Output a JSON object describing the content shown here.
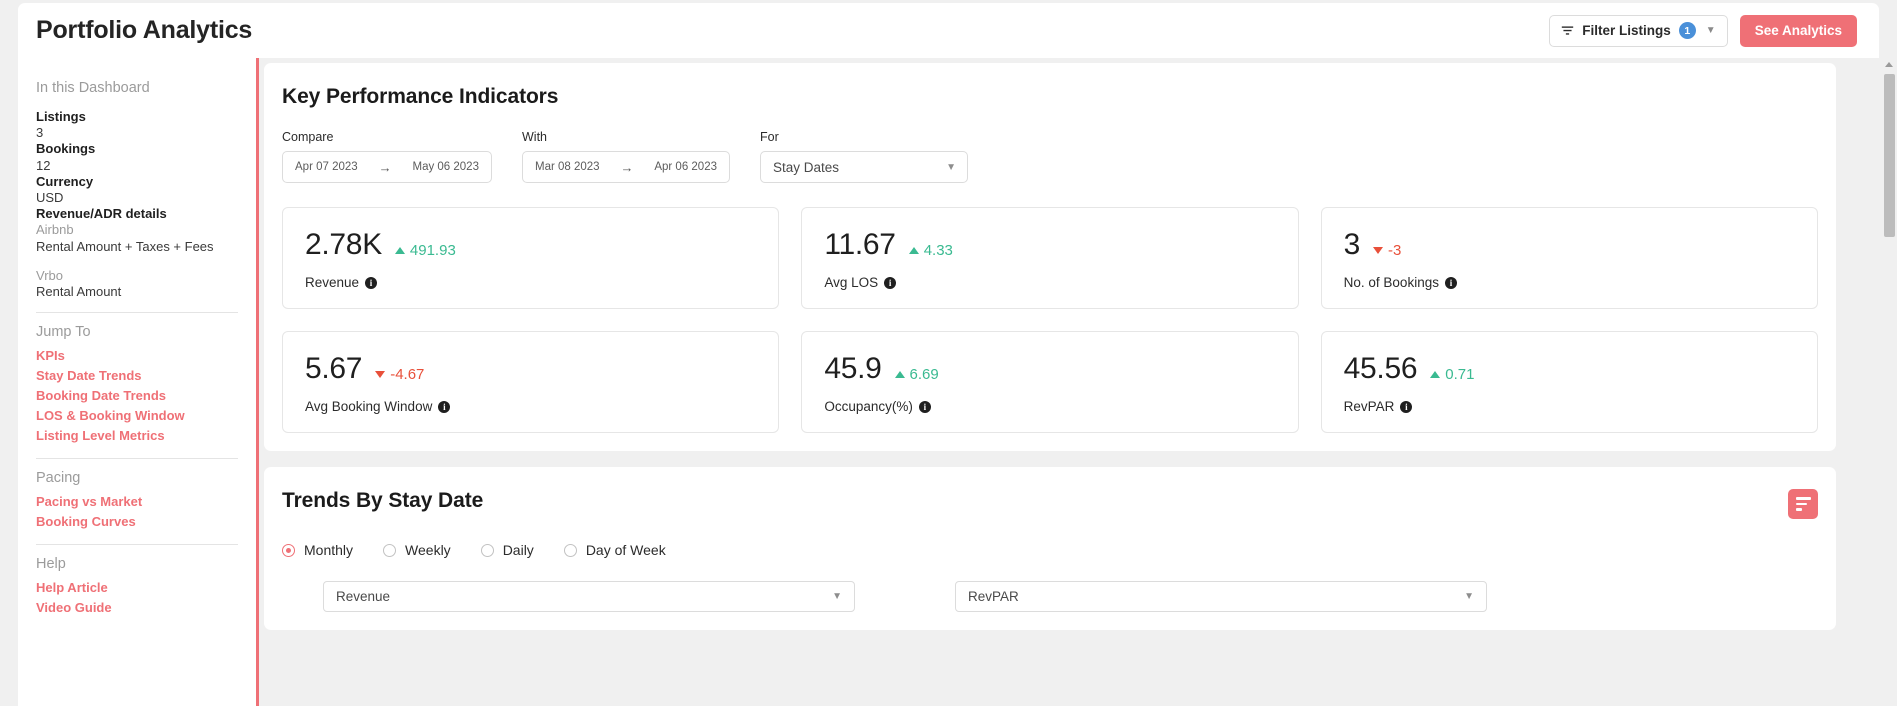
{
  "header": {
    "title": "Portfolio Analytics",
    "filter_button": {
      "label": "Filter Listings",
      "count": "1",
      "icon": "filter-icon"
    },
    "primary_button": {
      "label": "See Analytics"
    }
  },
  "sidebar": {
    "group_title": "In this Dashboard",
    "stats": [
      {
        "key": "Listings",
        "value": "3"
      },
      {
        "key": "Bookings",
        "value": "12"
      },
      {
        "key": "Currency",
        "value": "USD"
      }
    ],
    "revenue_details_title": "Revenue/ADR details",
    "channels": [
      {
        "name": "Airbnb",
        "formula": "Rental Amount + Taxes + Fees"
      },
      {
        "name": "Vrbo",
        "formula": "Rental Amount"
      }
    ],
    "jump_to": {
      "title": "Jump To",
      "links": [
        "KPIs",
        "Stay Date Trends",
        "Booking Date Trends",
        "LOS & Booking Window",
        "Listing Level Metrics"
      ]
    },
    "pacing": {
      "title": "Pacing",
      "links": [
        "Pacing vs Market",
        "Booking Curves"
      ]
    },
    "help": {
      "title": "Help",
      "links": [
        "Help Article",
        "Video Guide"
      ]
    }
  },
  "kpi_section": {
    "title": "Key Performance Indicators",
    "filters": {
      "compare": {
        "label": "Compare",
        "start": "Apr 07 2023",
        "end": "May 06 2023",
        "arrow": "→"
      },
      "with": {
        "label": "With",
        "start": "Mar 08 2023",
        "end": "Apr 06 2023",
        "arrow": "→"
      },
      "for": {
        "label": "For",
        "value": "Stay Dates"
      }
    },
    "cards": [
      {
        "value": "2.78K",
        "delta": "491.93",
        "direction": "up",
        "label": "Revenue"
      },
      {
        "value": "11.67",
        "delta": "4.33",
        "direction": "up",
        "label": "Avg LOS"
      },
      {
        "value": "3",
        "delta": "-3",
        "direction": "down",
        "label": "No. of Bookings"
      },
      {
        "value": "5.67",
        "delta": "-4.67",
        "direction": "down",
        "label": "Avg Booking Window"
      },
      {
        "value": "45.9",
        "delta": "6.69",
        "direction": "up",
        "label": "Occupancy(%)"
      },
      {
        "value": "45.56",
        "delta": "0.71",
        "direction": "up",
        "label": "RevPAR"
      }
    ]
  },
  "trends_section": {
    "title": "Trends By Stay Date",
    "granularity": [
      {
        "label": "Monthly",
        "selected": true
      },
      {
        "label": "Weekly",
        "selected": false
      },
      {
        "label": "Daily",
        "selected": false
      },
      {
        "label": "Day of Week",
        "selected": false
      }
    ],
    "metric_left": "Revenue",
    "metric_right": "RevPAR"
  },
  "colors": {
    "accent": "#ef7076",
    "positive": "#3aba91",
    "negative": "#e8503a",
    "badge": "#4a90d9"
  }
}
